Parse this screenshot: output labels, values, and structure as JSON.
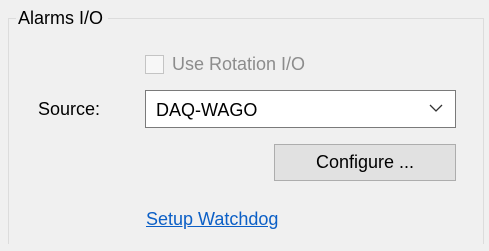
{
  "group": {
    "title": "Alarms I/O"
  },
  "rotation_checkbox": {
    "label": "Use Rotation I/O",
    "checked": false,
    "enabled": false
  },
  "source": {
    "label": "Source:",
    "selected": "DAQ-WAGO"
  },
  "configure_button": {
    "label": "Configure ..."
  },
  "watchdog_link": {
    "label": "Setup Watchdog"
  },
  "icons": {
    "dropdown": "chevron-down-icon"
  },
  "colors": {
    "background": "#f0f0f0",
    "link": "#0b5fc6",
    "disabled_text": "#8c8c8c",
    "button_face": "#e1e1e1"
  }
}
